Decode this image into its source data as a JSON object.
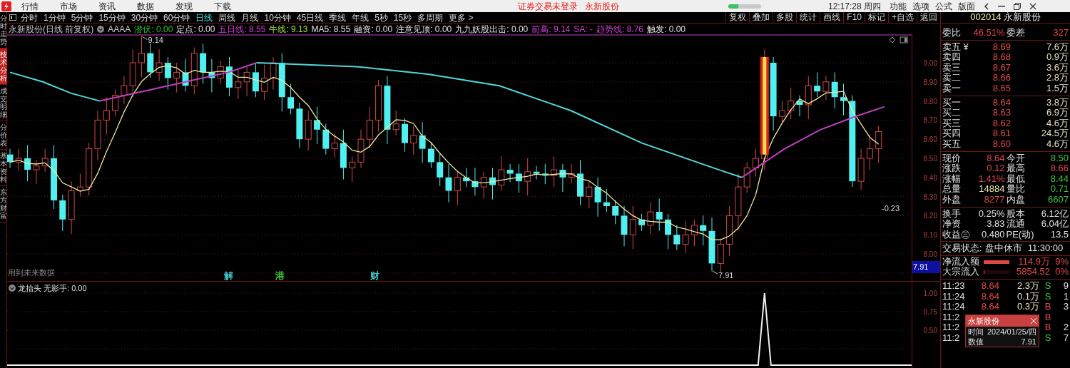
{
  "title_bar": {
    "menu": [
      "行情",
      "市场",
      "资讯",
      "数据",
      "发现",
      "下载"
    ],
    "notice": "证券交易未登录",
    "stock_name": "永新股份",
    "progress": {
      "level": 0.3
    },
    "clock": "12:17:28 周四",
    "tools": [
      "功能",
      "选项",
      "公式",
      "版面"
    ]
  },
  "side_tabs": [
    {
      "label": "分时走势",
      "selected": false
    },
    {
      "label": "技术分析",
      "selected": true
    },
    {
      "label": "成交明细",
      "selected": false
    },
    {
      "label": "分价表",
      "selected": false
    },
    {
      "label": "基本资料",
      "selected": false
    },
    {
      "label": "东方财富",
      "selected": false
    }
  ],
  "periods": [
    {
      "label": "分时",
      "selected": false
    },
    {
      "label": "1分钟",
      "selected": false
    },
    {
      "label": "5分钟",
      "selected": false
    },
    {
      "label": "15分钟",
      "selected": false
    },
    {
      "label": "30分钟",
      "selected": false
    },
    {
      "label": "60分钟",
      "selected": false
    },
    {
      "label": "日线",
      "selected": true
    },
    {
      "label": "周线",
      "selected": false
    },
    {
      "label": "月线",
      "selected": false
    },
    {
      "label": "10分钟",
      "selected": false
    },
    {
      "label": "45日线",
      "selected": false
    },
    {
      "label": "季线",
      "selected": false
    },
    {
      "label": "年线",
      "selected": false
    },
    {
      "label": "5秒",
      "selected": false
    },
    {
      "label": "15秒",
      "selected": false
    },
    {
      "label": "多周期",
      "selected": false
    },
    {
      "label": "更多 >",
      "selected": false
    }
  ],
  "toolbar": [
    "复权",
    "叠加",
    "多股",
    "统计",
    "画线",
    "F10",
    "标记",
    "+自选",
    "返回"
  ],
  "legend": [
    {
      "text": "永新股份(日线 前复权)",
      "color": "#c8c8c8"
    },
    {
      "text": "AAAA",
      "color": "#c8c8c8"
    },
    {
      "text": "潜伏: 0.00",
      "color": "#30c030"
    },
    {
      "text": "定点: 0.00",
      "color": "#e0e0e0"
    },
    {
      "text": "五日线: 8.55",
      "color": "#d040d0"
    },
    {
      "text": "牛线: 9.13",
      "color": "#a0e040"
    },
    {
      "text": "MA5: 8.55",
      "color": "#e0e0e0"
    },
    {
      "text": "融资: 0.00",
      "color": "#e0e0e0"
    },
    {
      "text": "注意见顶: 0.00",
      "color": "#e0e0e0"
    },
    {
      "text": "九九妖股出击: 0.00",
      "color": "#e0e0e0"
    },
    {
      "text": "前高: 9.14",
      "color": "#d040d0"
    },
    {
      "text": "SA: -",
      "color": "#d040d0"
    },
    {
      "text": "趋势线: 8.76",
      "color": "#d040d0"
    },
    {
      "text": "触发: 0.00",
      "color": "#e0e0e0"
    }
  ],
  "price_axis": [
    "9.00",
    "8.90",
    "8.80",
    "8.70",
    "8.60",
    "8.50",
    "8.40",
    "8.30",
    "8.20",
    "8.10",
    "8.00"
  ],
  "price_marker": "7.91",
  "chart_notes": {
    "high": "9.14",
    "low": "7.91",
    "change": "-0.23",
    "warning": "用到未来数据"
  },
  "event_marks": [
    {
      "label": "解",
      "color": "#40c8c8"
    },
    {
      "label": "港",
      "color": "#40c040"
    },
    {
      "label": "财",
      "color": "#40c8c8"
    }
  ],
  "sub_chart": {
    "legend": "龙抬头 无影手: 0.00",
    "axis": [
      "1.00",
      "0.75",
      "0.50"
    ]
  },
  "quote": {
    "code": "002014",
    "name": "永新股份",
    "summary": [
      {
        "label": "委比",
        "value": "46.51%",
        "color": "#e04848"
      },
      {
        "label": "委差",
        "value": "327",
        "color": "#e04848"
      }
    ],
    "asks": [
      {
        "label": "卖五 ¥",
        "price": "8.69",
        "volume": "7.6万"
      },
      {
        "label": "卖四",
        "price": "8.68",
        "volume": "0.9万"
      },
      {
        "label": "卖三",
        "price": "8.67",
        "volume": "3.6万"
      },
      {
        "label": "卖二",
        "price": "8.66",
        "volume": "2.8万"
      },
      {
        "label": "卖一",
        "price": "8.65",
        "volume": "1.5万"
      }
    ],
    "bids": [
      {
        "label": "买一",
        "price": "8.64",
        "volume": "3.8万"
      },
      {
        "label": "买二",
        "price": "8.63",
        "volume": "6.9万"
      },
      {
        "label": "买三",
        "price": "8.62",
        "volume": "4.6万"
      },
      {
        "label": "买四",
        "price": "8.61",
        "volume": "24.5万"
      },
      {
        "label": "买五",
        "price": "8.60",
        "volume": "4.6万"
      }
    ],
    "stats": [
      {
        "label": "现价",
        "value": "8.64",
        "color": "#e04848"
      },
      {
        "label": "今开",
        "value": "8.50",
        "color": "#40c040"
      },
      {
        "label": "涨跌",
        "value": "0.12",
        "color": "#e04848"
      },
      {
        "label": "最高",
        "value": "8.66",
        "color": "#e04848"
      },
      {
        "label": "涨幅",
        "value": "1.41%",
        "color": "#e04848"
      },
      {
        "label": "最低",
        "value": "8.44",
        "color": "#40c040"
      },
      {
        "label": "总量",
        "value": "14884",
        "color": "#e8e0a8"
      },
      {
        "label": "量比",
        "value": "0.71",
        "color": "#40c040"
      },
      {
        "label": "外盘",
        "value": "8277",
        "color": "#e04848"
      },
      {
        "label": "内盘",
        "value": "6607",
        "color": "#40c040"
      }
    ],
    "fundamentals": [
      {
        "label": "换手",
        "value": "0.25%"
      },
      {
        "label": "股本",
        "value": "6.12亿"
      },
      {
        "label": "净资",
        "value": "3.83"
      },
      {
        "label": "流通",
        "value": "6.04亿"
      },
      {
        "label": "收益㊂",
        "value": "0.480"
      },
      {
        "label": "PE(动)",
        "value": "13.5"
      }
    ],
    "status": {
      "label": "交易状态:",
      "value": "盘中休市",
      "time": "11:30:00"
    },
    "flows": [
      {
        "label": "净流入额",
        "level": 1,
        "amount": "114.9万",
        "share": "9%"
      },
      {
        "label": "大宗流入",
        "level": 0.02,
        "amount": "5854.52",
        "share": "0%"
      }
    ],
    "ticks": [
      {
        "time": "11:23",
        "price": "8.64",
        "volume": "2.3万",
        "side": "S",
        "color": "#40c040",
        "count": "9"
      },
      {
        "time": "11:24",
        "price": "8.64",
        "volume": "0.1万",
        "side": "S",
        "color": "#40c040",
        "count": "1"
      },
      {
        "time": "11:24",
        "price": "8.64",
        "volume": "0.3万",
        "side": "B",
        "color": "#e04848",
        "count": "3"
      },
      {
        "time": "11:2",
        "side": "B",
        "color": "#e04848"
      },
      {
        "time": "11:2",
        "side": "B",
        "color": "#e04848",
        "count": "2"
      },
      {
        "time": "11:2",
        "side": "S",
        "color": "#40c040",
        "count": "7"
      }
    ],
    "popup": {
      "title": "永新股份",
      "rows": [
        {
          "label": "时间",
          "value": "2024/01/25/四"
        },
        {
          "label": "数值",
          "value": "7.91"
        }
      ]
    }
  }
}
